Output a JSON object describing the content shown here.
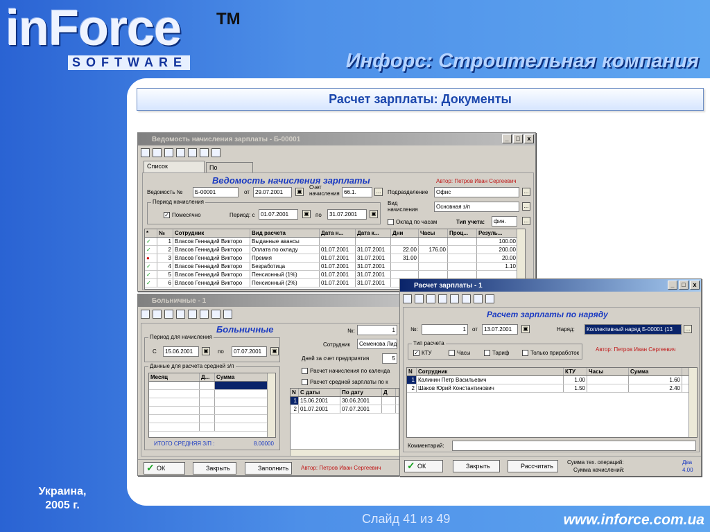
{
  "logo": {
    "main": "inForce",
    "sub": "SOFTWARE",
    "tm": "TM"
  },
  "slide_title": "Инфорс: Строительная компания",
  "section_title": "Расчет зарплаты: Документы",
  "footer": {
    "country": "Украина,",
    "year": "2005 г.",
    "slide_num": "Слайд 41 из 49",
    "site": "www.inforce.com.ua"
  },
  "payroll": {
    "window_title": "Ведомость начисления зарплаты - Б-00001",
    "tabs": [
      "Список сотрудников",
      "По сотруднику"
    ],
    "heading": "Ведомость начисления зарплаты",
    "author": "Автор: Петров Иван Сергеевич",
    "doc_label": "Ведомость №",
    "doc_no": "Б-00001",
    "from_label": "от",
    "doc_date": "29.07.2001",
    "account_label": "Счет начисления",
    "account": "66.1.",
    "department_label": "Подразделение",
    "department": "Офис",
    "period_legend": "Период начисления",
    "monthly_label": "Помесячно",
    "period_label": "Период: с",
    "period_from": "01.07.2001",
    "to_label": "по",
    "period_to": "31.07.2001",
    "type_label": "Вид начисления",
    "type": "Основная з/п",
    "hourly_label": "Оклад по часам",
    "account_type_label": "Тип учета:",
    "account_type": "фин.",
    "columns": [
      "*",
      "№",
      "Сотрудник",
      "Вид расчета",
      "Дата н...",
      "Дата к...",
      "Дни",
      "Часы",
      "Проц...",
      "Резуль..."
    ],
    "rows": [
      [
        "1",
        "Власов Геннадий Викторо",
        "Выданные авансы",
        "",
        "",
        "",
        "",
        "",
        "100.00"
      ],
      [
        "2",
        "Власов Геннадий Викторо",
        "Оплата по окладу",
        "01.07.2001",
        "31.07.2001",
        "22.00",
        "176.00",
        "",
        "200.00"
      ],
      [
        "3",
        "Власов Геннадий Викторо",
        "Премия",
        "01.07.2001",
        "31.07.2001",
        "31.00",
        "",
        "",
        "20.00"
      ],
      [
        "4",
        "Власов Геннадий Викторо",
        "Безработица",
        "01.07.2001",
        "31.07.2001",
        "",
        "",
        "",
        "1.10"
      ],
      [
        "5",
        "Власов Геннадий Викторо",
        "Пенсионный (1%)",
        "01.07.2001",
        "31.07.2001",
        "",
        "",
        "",
        ""
      ],
      [
        "6",
        "Власов Геннадий Викторо",
        "Пенсионный (2%)",
        "01.07.2001",
        "31.07.2001",
        "",
        "",
        "",
        ""
      ]
    ]
  },
  "sick": {
    "window_title": "Больничные - 1",
    "heading": "Больничные",
    "no_label": "№:",
    "no": "1",
    "period_legend": "Период для начисления",
    "from_label": "С",
    "from": "15.06.2001",
    "to_label": "по",
    "to": "07.07.2001",
    "employee_label": "Сотрудник",
    "employee": "Семенова Лид",
    "days_label": "Дней за счет предприятия",
    "days": "5",
    "avg_legend": "Данные для расчета средней з/п",
    "calc_label": "Расчет начисления по календа",
    "avg_calc_label": "Расчет средней зарплаты по к",
    "avg_columns": [
      "Месяц",
      "Д...",
      "Сумма"
    ],
    "avg_total_label": "ИТОГО СРЕДНЯЯ З/П :",
    "avg_total": "8.00000",
    "period_columns": [
      "N",
      "С даты",
      "По дату",
      "Д"
    ],
    "period_rows": [
      [
        "1",
        "15.06.2001",
        "30.06.2001"
      ],
      [
        "2",
        "01.07.2001",
        "07.07.2001"
      ]
    ],
    "author": "Автор: Петров Иван Сергеевич",
    "ok": "ОК",
    "close": "Закрыть",
    "fill": "Заполнить"
  },
  "team": {
    "window_title": "Расчет зарплаты - 1",
    "heading": "Расчет зарплаты по наряду",
    "no_label": "№:",
    "no": "1",
    "from_label": "от",
    "date": "13.07.2001",
    "order_label": "Наряд:",
    "order": "Коллективный наряд Б-00001 (13",
    "calc_type_legend": "Тип расчета",
    "options": [
      "КТУ",
      "Часы",
      "Тариф",
      "Только приработок"
    ],
    "author": "Автор: Петров Иван Сергеевич",
    "columns": [
      "N",
      "Сотрудник",
      "КТУ",
      "Часы",
      "Сумма"
    ],
    "rows": [
      [
        "1",
        "Калинин Петр Васильевич",
        "1.00",
        "",
        "1.60"
      ],
      [
        "2",
        "Шаков Юрий Константинович",
        "1.50",
        "",
        "2.40"
      ]
    ],
    "comment_label": "Комментарий:",
    "ok": "ОК",
    "close": "Закрыть",
    "calc": "Рассчитать",
    "ops_sum_label": "Сумма тех. операций:",
    "ops_sum": "Два",
    "accruals_label": "Сумма начислений:",
    "accruals": "4.00"
  }
}
